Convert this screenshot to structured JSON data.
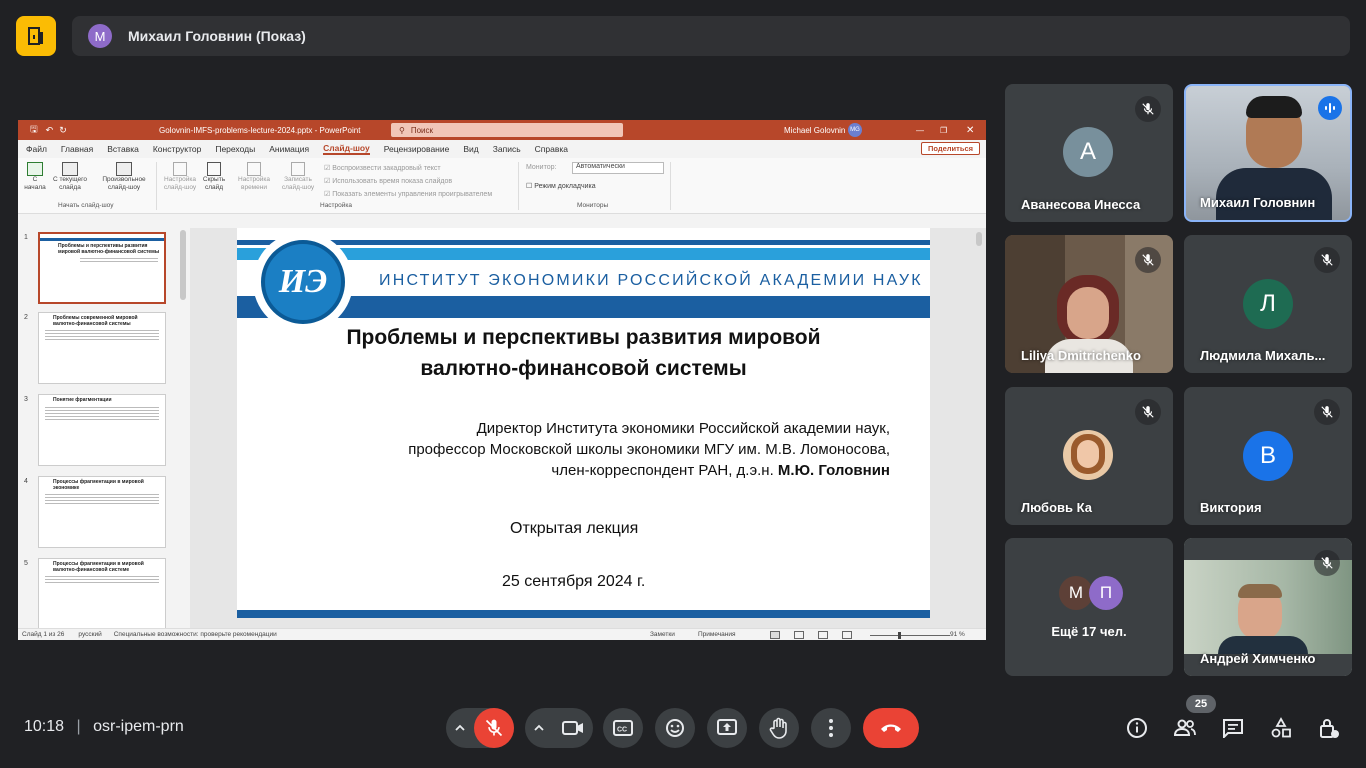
{
  "meeting": {
    "presenter_initial": "М",
    "presenter_label": "Михаил Головнин (Показ)",
    "time": "10:18",
    "code": "osr-ipem-prn",
    "participant_count": "25",
    "more_count_label": "Ещё 17 чел.",
    "more_initials": [
      "М",
      "П"
    ]
  },
  "ppt": {
    "window_title": "Golovnin-IMFS-problems-lecture-2024.pptx - PowerPoint",
    "search_placeholder": "Поиск",
    "user": "Michael Golovnin",
    "user_initials": "MG",
    "menu": [
      "Файл",
      "Главная",
      "Вставка",
      "Конструктор",
      "Переходы",
      "Анимация",
      "Слайд-шоу",
      "Рецензирование",
      "Вид",
      "Запись",
      "Справка"
    ],
    "share_label": "Поделиться",
    "ribbon": {
      "from_start": "С начала",
      "from_current": "С текущего слайда",
      "custom": "Произвольное слайд-шоу",
      "group_start": "Начать слайд-шоу",
      "setup": "Настройка слайд-шоу",
      "hide": "Скрыть слайд",
      "rehearse": "Настройка времени",
      "record": "Записать слайд-шоу",
      "chk1": "Воспроизвести закадровый текст",
      "chk2": "Использовать время показа слайдов",
      "chk3": "Показать элементы управления проигрывателем",
      "group_setup": "Настройка",
      "monitor_label": "Монитор:",
      "monitor_value": "Автоматически",
      "presenter_view": "Режим докладчика",
      "group_monitors": "Мониторы"
    },
    "thumbs": [
      {
        "num": "1",
        "title": "Проблемы и перспективы развития мировой валютно-финансовой системы"
      },
      {
        "num": "2",
        "title": "Проблемы современной мировой валютно-финансовой системы"
      },
      {
        "num": "3",
        "title": "Понятие фрагментации"
      },
      {
        "num": "4",
        "title": "Процессы фрагментации в мировой экономике"
      },
      {
        "num": "5",
        "title": "Процессы фрагментации в мировой валютно-финансовой системе"
      }
    ],
    "status": {
      "slide": "Слайд 1 из 26",
      "lang": "русский",
      "access": "Специальные возможности: проверьте рекомендации",
      "notes": "Заметки",
      "comments": "Примечания",
      "zoom": "91 %"
    },
    "slide": {
      "institute": "ИНСТИТУТ ЭКОНОМИКИ РОССИЙСКОЙ АКАДЕМИИ НАУК",
      "logo_text": "ИЭ",
      "title_line1": "Проблемы и перспективы развития мировой",
      "title_line2": "валютно-финансовой системы",
      "author_line1": "Директор Института экономики Российской академии наук,",
      "author_line2": "профессор Московской школы экономики МГУ им. М.В. Ломоносова,",
      "author_line3": "член-корреспондент РАН, д.э.н.",
      "author_name": "М.Ю. Головнин",
      "lecture": "Открытая лекция",
      "date": "25 сентября 2024 г."
    }
  },
  "participants": [
    {
      "name": "Аванесова Инесса",
      "initial": "А",
      "color": "#78909c"
    },
    {
      "name": "Михаил Головнин"
    },
    {
      "name": "Liliya Dmitrichenko"
    },
    {
      "name": "Людмила Михаль...",
      "initial": "Л",
      "color": "#1e6b52"
    },
    {
      "name": "Любовь Ка"
    },
    {
      "name": "Виктория",
      "initial": "В",
      "color": "#1a73e8"
    },
    {
      "name": "Андрей Химченко"
    }
  ]
}
